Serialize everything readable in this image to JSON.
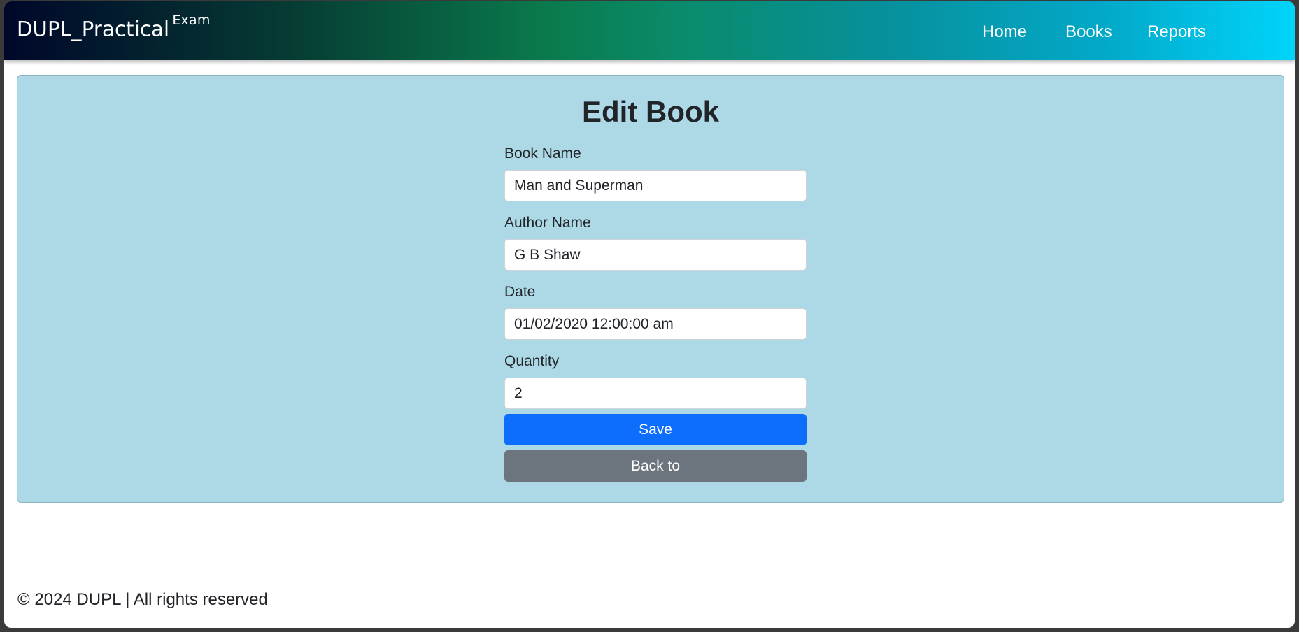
{
  "navbar": {
    "brand": "DUPL_Practical",
    "brand_sup": "Exam",
    "links": [
      {
        "label": "Home"
      },
      {
        "label": "Books"
      },
      {
        "label": "Reports"
      }
    ]
  },
  "form": {
    "title": "Edit Book",
    "fields": [
      {
        "label": "Book Name",
        "value": "Man and Superman"
      },
      {
        "label": "Author Name",
        "value": "G B Shaw"
      },
      {
        "label": "Date",
        "value": "01/02/2020 12:00:00 am"
      },
      {
        "label": "Quantity",
        "value": "2"
      }
    ],
    "save_label": "Save",
    "back_label": "Back to"
  },
  "footer": {
    "text": "© 2024 DUPL | All rights reserved"
  },
  "colors": {
    "panel_bg": "#add8e6",
    "primary": "#0d6efd",
    "secondary": "#6c757d"
  }
}
